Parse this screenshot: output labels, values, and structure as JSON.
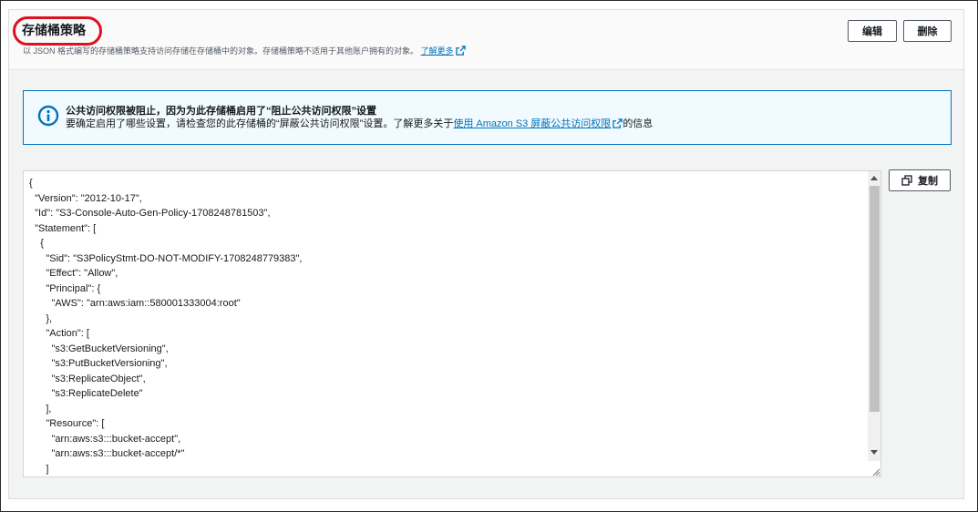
{
  "header": {
    "title": "存储桶策略",
    "description": "以 JSON 格式编写的存储桶策略支持访问存储在存储桶中的对象。存储桶策略不适用于其他账户拥有的对象。",
    "learn_more": "了解更多",
    "edit_label": "编辑",
    "delete_label": "删除"
  },
  "alert": {
    "title": "公共访问权限被阻止，因为为此存储桶启用了“阻止公共访问权限”设置",
    "body_prefix": "要确定启用了哪些设置，请检查您的此存储桶的“屏蔽公共访问权限”设置。了解更多关于",
    "link": "使用 Amazon S3 屏蔽公共访问权限",
    "body_suffix": "的信息"
  },
  "policy_editor": {
    "content": "{\n  \"Version\": \"2012-10-17\",\n  \"Id\": \"S3-Console-Auto-Gen-Policy-1708248781503\",\n  \"Statement\": [\n    {\n      \"Sid\": \"S3PolicyStmt-DO-NOT-MODIFY-1708248779383\",\n      \"Effect\": \"Allow\",\n      \"Principal\": {\n        \"AWS\": \"arn:aws:iam::580001333004:root\"\n      },\n      \"Action\": [\n        \"s3:GetBucketVersioning\",\n        \"s3:PutBucketVersioning\",\n        \"s3:ReplicateObject\",\n        \"s3:ReplicateDelete\"\n      ],\n      \"Resource\": [\n        \"arn:aws:s3:::bucket-accept\",\n        \"arn:aws:s3:::bucket-accept/*\"\n      ]\n    }",
    "copy_label": "复制"
  },
  "colors": {
    "accent": "#0073bb",
    "highlight": "#e0101c",
    "info_bg": "#f1faff"
  },
  "icons": [
    "external-link-icon",
    "info-icon",
    "copy-icon"
  ]
}
